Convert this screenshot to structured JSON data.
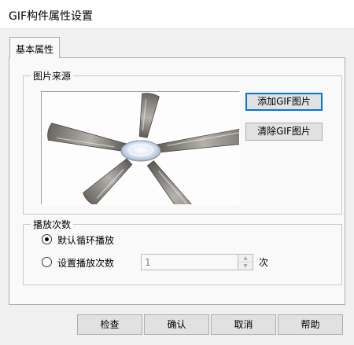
{
  "window": {
    "title": "GIF构件属性设置"
  },
  "tabs": [
    {
      "label": "基本属性",
      "selected": true
    }
  ],
  "image_source": {
    "group_title": "图片来源",
    "add_button": "添加GIF图片",
    "clear_button": "清除GIF图片",
    "preview_icon": "ceiling-fan-icon"
  },
  "playback": {
    "group_title": "播放次数",
    "option_loop": {
      "label": "默认循环播放",
      "checked": true
    },
    "option_count": {
      "label": "设置播放次数",
      "checked": false
    },
    "count_value": "1",
    "unit": "次"
  },
  "footer": {
    "check_label": "检查",
    "ok_label": "确认",
    "cancel_label": "取消",
    "help_label": "帮助"
  },
  "colors": {
    "accent": "#0078d7",
    "window_bg": "#f0f0f0"
  }
}
